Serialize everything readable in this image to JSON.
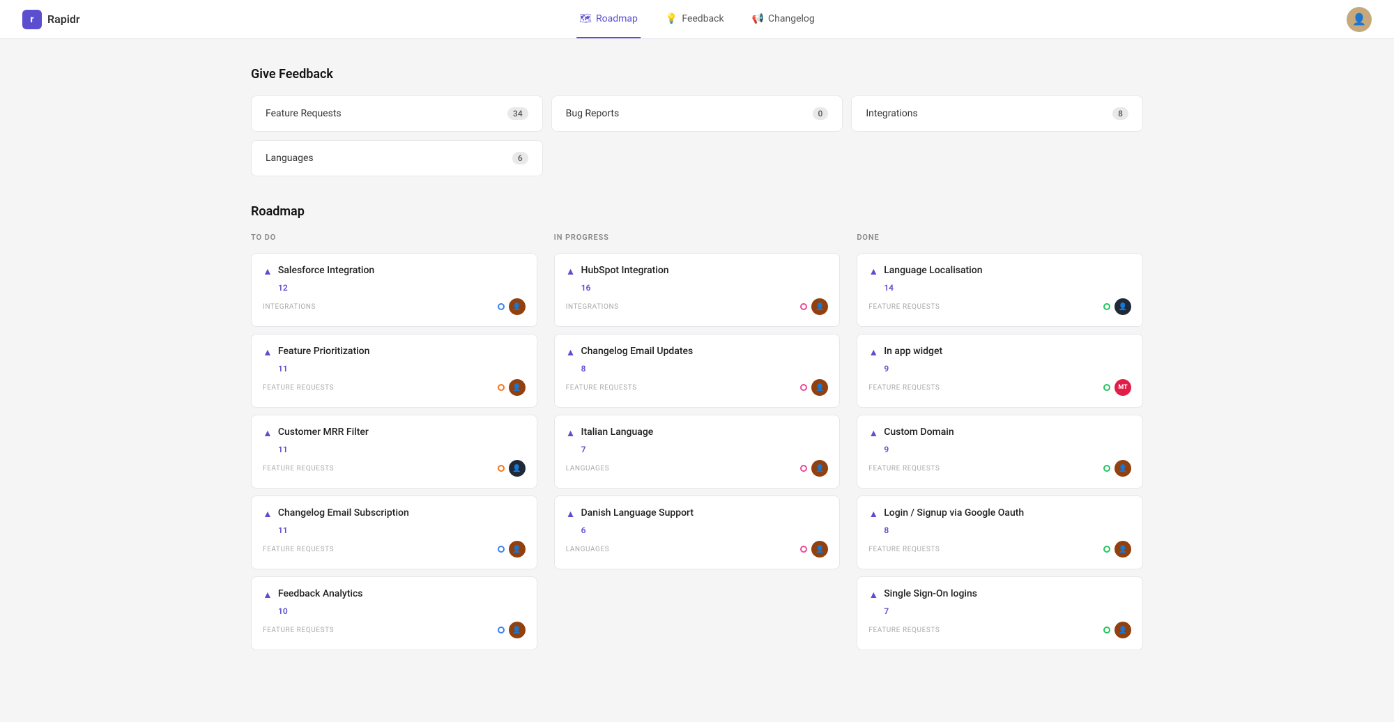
{
  "brand": {
    "logo_letter": "r",
    "name": "Rapidr"
  },
  "nav": {
    "items": [
      {
        "id": "roadmap",
        "label": "Roadmap",
        "active": true,
        "icon": "map-icon"
      },
      {
        "id": "feedback",
        "label": "Feedback",
        "active": false,
        "icon": "lightbulb-icon"
      },
      {
        "id": "changelog",
        "label": "Changelog",
        "active": false,
        "icon": "megaphone-icon"
      }
    ]
  },
  "feedback_section": {
    "title": "Give Feedback",
    "categories": [
      {
        "label": "Feature Requests",
        "count": "34"
      },
      {
        "label": "Bug Reports",
        "count": "0"
      },
      {
        "label": "Integrations",
        "count": "8"
      }
    ],
    "categories_row2": [
      {
        "label": "Languages",
        "count": "6"
      },
      {
        "label": "",
        "count": ""
      },
      {
        "label": "",
        "count": ""
      }
    ]
  },
  "roadmap_section": {
    "title": "Roadmap",
    "columns": [
      {
        "id": "todo",
        "header": "TO DO",
        "cards": [
          {
            "title": "Salesforce Integration",
            "votes": "12",
            "category": "INTEGRATIONS",
            "dot": "blue",
            "avatar": "brown"
          },
          {
            "title": "Feature Prioritization",
            "votes": "11",
            "category": "FEATURE REQUESTS",
            "dot": "orange",
            "avatar": "brown"
          },
          {
            "title": "Customer MRR Filter",
            "votes": "11",
            "category": "FEATURE REQUESTS",
            "dot": "orange",
            "avatar": "dark"
          },
          {
            "title": "Changelog Email Subscription",
            "votes": "11",
            "category": "FEATURE REQUESTS",
            "dot": "blue",
            "avatar": "brown"
          },
          {
            "title": "Feedback Analytics",
            "votes": "10",
            "category": "FEATURE REQUESTS",
            "dot": "blue",
            "avatar": "brown"
          }
        ]
      },
      {
        "id": "inprogress",
        "header": "IN PROGRESS",
        "cards": [
          {
            "title": "HubSpot Integration",
            "votes": "16",
            "category": "INTEGRATIONS",
            "dot": "pink",
            "avatar": "brown"
          },
          {
            "title": "Changelog Email Updates",
            "votes": "8",
            "category": "FEATURE REQUESTS",
            "dot": "pink",
            "avatar": "brown"
          },
          {
            "title": "Italian Language",
            "votes": "7",
            "category": "LANGUAGES",
            "dot": "pink",
            "avatar": "brown"
          },
          {
            "title": "Danish Language Support",
            "votes": "6",
            "category": "LANGUAGES",
            "dot": "pink",
            "avatar": "brown"
          }
        ]
      },
      {
        "id": "done",
        "header": "DONE",
        "cards": [
          {
            "title": "Language Localisation",
            "votes": "14",
            "category": "FEATURE REQUESTS",
            "dot": "green",
            "avatar": "dark"
          },
          {
            "title": "In app widget",
            "votes": "9",
            "category": "FEATURE REQUESTS",
            "dot": "green",
            "avatar": "mt"
          },
          {
            "title": "Custom Domain",
            "votes": "9",
            "category": "FEATURE REQUESTS",
            "dot": "green",
            "avatar": "brown"
          },
          {
            "title": "Login / Signup via Google Oauth",
            "votes": "8",
            "category": "FEATURE REQUESTS",
            "dot": "green",
            "avatar": "brown"
          },
          {
            "title": "Single Sign-On logins",
            "votes": "7",
            "category": "FEATURE REQUESTS",
            "dot": "green",
            "avatar": "brown"
          }
        ]
      }
    ]
  }
}
